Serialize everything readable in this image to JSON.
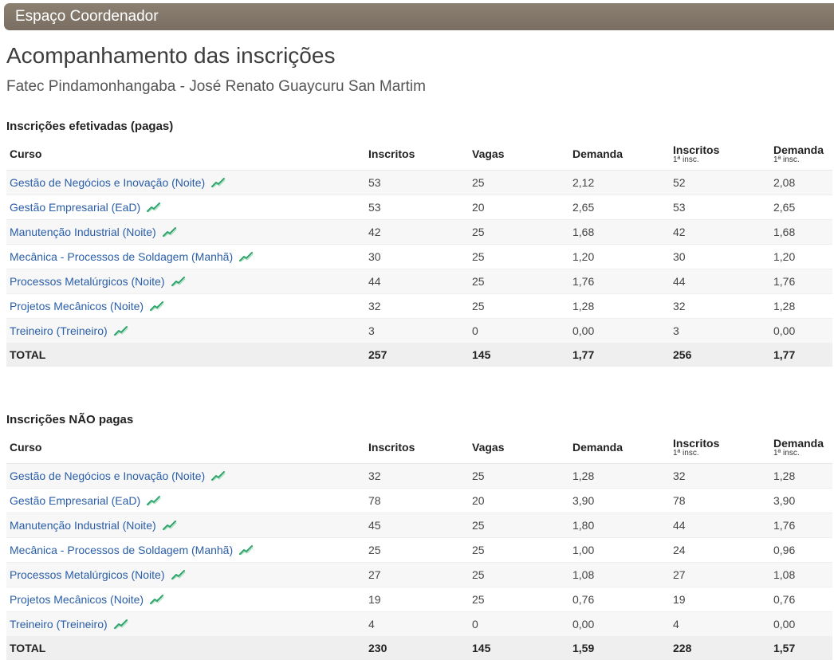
{
  "header": {
    "title": "Espaço Coordenador"
  },
  "page": {
    "title": "Acompanhamento das inscrições",
    "unit": "Fatec Pindamonhangaba - José Renato Guaycuru San Martim"
  },
  "columns": {
    "curso": "Curso",
    "inscritos": "Inscritos",
    "vagas": "Vagas",
    "demanda": "Demanda",
    "inscritos1": "Inscritos",
    "inscritos1_sub": "1ª insc.",
    "demanda1": "Demanda",
    "demanda1_sub": "1ª insc."
  },
  "icons": {
    "trend": "trend-chart-icon",
    "trend_color": "#2ea36b"
  },
  "colors": {
    "header_bar": "#7f7367",
    "link": "#2a5ea8"
  },
  "paid": {
    "title": "Inscrições efetivadas (pagas)",
    "rows": [
      {
        "curso": "Gestão de Negócios e Inovação (Noite)",
        "inscritos": "53",
        "vagas": "25",
        "demanda": "2,12",
        "inscritos1": "52",
        "demanda1": "2,08"
      },
      {
        "curso": "Gestão Empresarial (EaD)",
        "inscritos": "53",
        "vagas": "20",
        "demanda": "2,65",
        "inscritos1": "53",
        "demanda1": "2,65"
      },
      {
        "curso": "Manutenção Industrial (Noite)",
        "inscritos": "42",
        "vagas": "25",
        "demanda": "1,68",
        "inscritos1": "42",
        "demanda1": "1,68"
      },
      {
        "curso": "Mecânica - Processos de Soldagem (Manhã)",
        "inscritos": "30",
        "vagas": "25",
        "demanda": "1,20",
        "inscritos1": "30",
        "demanda1": "1,20"
      },
      {
        "curso": "Processos Metalúrgicos (Noite)",
        "inscritos": "44",
        "vagas": "25",
        "demanda": "1,76",
        "inscritos1": "44",
        "demanda1": "1,76"
      },
      {
        "curso": "Projetos Mecânicos (Noite)",
        "inscritos": "32",
        "vagas": "25",
        "demanda": "1,28",
        "inscritos1": "32",
        "demanda1": "1,28"
      },
      {
        "curso": "Treineiro (Treineiro)",
        "inscritos": "3",
        "vagas": "0",
        "demanda": "0,00",
        "inscritos1": "3",
        "demanda1": "0,00"
      }
    ],
    "total": {
      "label": "TOTAL",
      "inscritos": "257",
      "vagas": "145",
      "demanda": "1,77",
      "inscritos1": "256",
      "demanda1": "1,77"
    }
  },
  "unpaid": {
    "title": "Inscrições NÃO pagas",
    "rows": [
      {
        "curso": "Gestão de Negócios e Inovação (Noite)",
        "inscritos": "32",
        "vagas": "25",
        "demanda": "1,28",
        "inscritos1": "32",
        "demanda1": "1,28"
      },
      {
        "curso": "Gestão Empresarial (EaD)",
        "inscritos": "78",
        "vagas": "20",
        "demanda": "3,90",
        "inscritos1": "78",
        "demanda1": "3,90"
      },
      {
        "curso": "Manutenção Industrial (Noite)",
        "inscritos": "45",
        "vagas": "25",
        "demanda": "1,80",
        "inscritos1": "44",
        "demanda1": "1,76"
      },
      {
        "curso": "Mecânica - Processos de Soldagem (Manhã)",
        "inscritos": "25",
        "vagas": "25",
        "demanda": "1,00",
        "inscritos1": "24",
        "demanda1": "0,96"
      },
      {
        "curso": "Processos Metalúrgicos (Noite)",
        "inscritos": "27",
        "vagas": "25",
        "demanda": "1,08",
        "inscritos1": "27",
        "demanda1": "1,08"
      },
      {
        "curso": "Projetos Mecânicos (Noite)",
        "inscritos": "19",
        "vagas": "25",
        "demanda": "0,76",
        "inscritos1": "19",
        "demanda1": "0,76"
      },
      {
        "curso": "Treineiro (Treineiro)",
        "inscritos": "4",
        "vagas": "0",
        "demanda": "0,00",
        "inscritos1": "4",
        "demanda1": "0,00"
      }
    ],
    "total": {
      "label": "TOTAL",
      "inscritos": "230",
      "vagas": "145",
      "demanda": "1,59",
      "inscritos1": "228",
      "demanda1": "1,57"
    }
  }
}
